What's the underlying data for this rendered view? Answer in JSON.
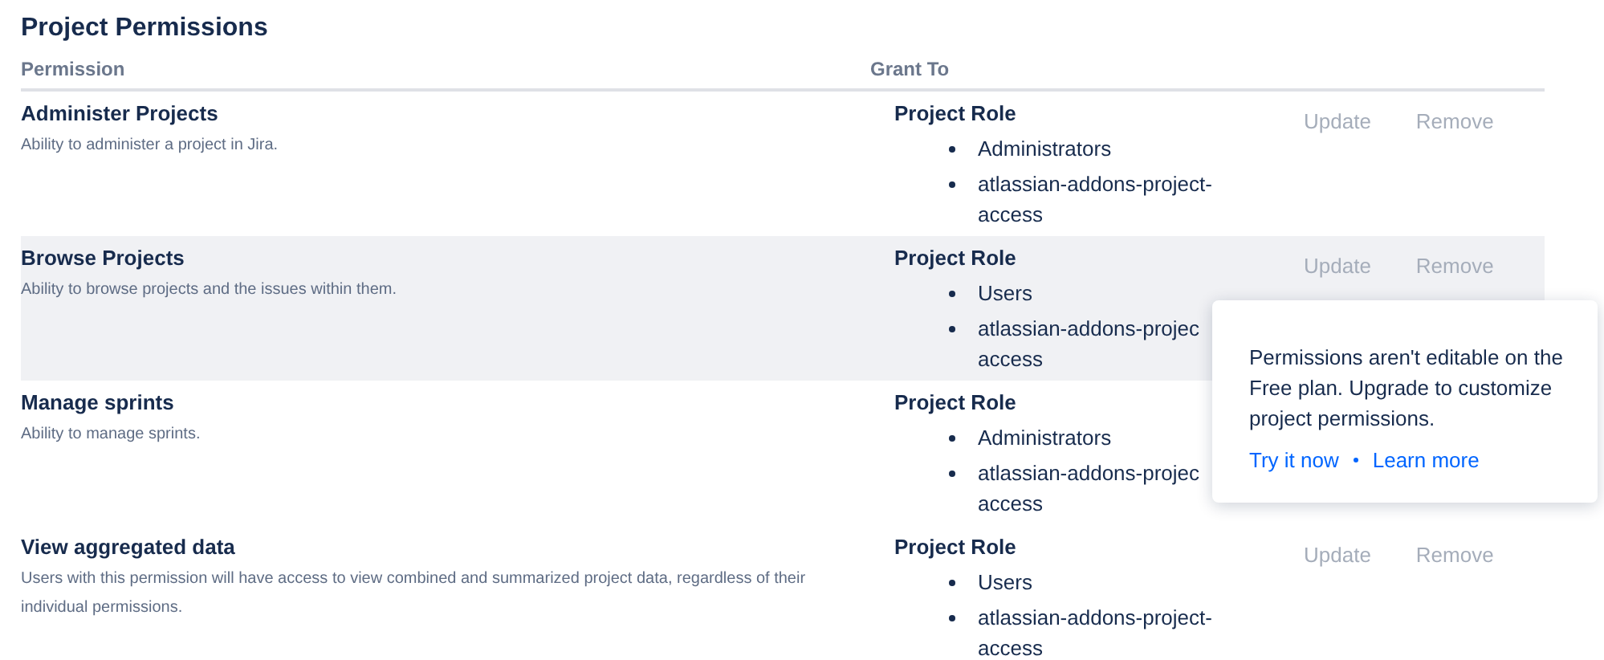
{
  "title": "Project Permissions",
  "table": {
    "columns": [
      "Permission",
      "Grant To"
    ],
    "rows": [
      {
        "name": "Administer Projects",
        "description": "Ability to administer a project in Jira.",
        "highlighted": false,
        "grant_heading": "Project Role",
        "grantees": [
          "Administrators",
          "atlassian-addons-project-access"
        ],
        "actions": [
          {
            "label": "Update",
            "disabled": true
          },
          {
            "label": "Remove",
            "disabled": true
          }
        ]
      },
      {
        "name": "Browse Projects",
        "description": "Ability to browse projects and the issues within them.",
        "highlighted": true,
        "grant_heading": "Project Role",
        "grantees": [
          "Users",
          "atlassian-addons-projec access"
        ],
        "actions": [
          {
            "label": "Update",
            "disabled": true
          },
          {
            "label": "Remove",
            "disabled": true
          }
        ]
      },
      {
        "name": "Manage sprints",
        "description": "Ability to manage sprints.",
        "highlighted": false,
        "grant_heading": "Project Role",
        "grantees": [
          "Administrators",
          "atlassian-addons-projec access"
        ],
        "actions": []
      },
      {
        "name": "View aggregated data",
        "description": "Users with this permission will have access to view combined and summarized project data, regardless of their individual permissions.",
        "highlighted": false,
        "grant_heading": "Project Role",
        "grantees": [
          "Users",
          "atlassian-addons-project-access"
        ],
        "actions": [
          {
            "label": "Update",
            "disabled": true
          },
          {
            "label": "Remove",
            "disabled": true
          }
        ]
      }
    ]
  },
  "popover": {
    "message": "Permissions aren't editable on the Free plan. Upgrade to customize project permissions.",
    "links": [
      "Try it now",
      "Learn more"
    ]
  }
}
